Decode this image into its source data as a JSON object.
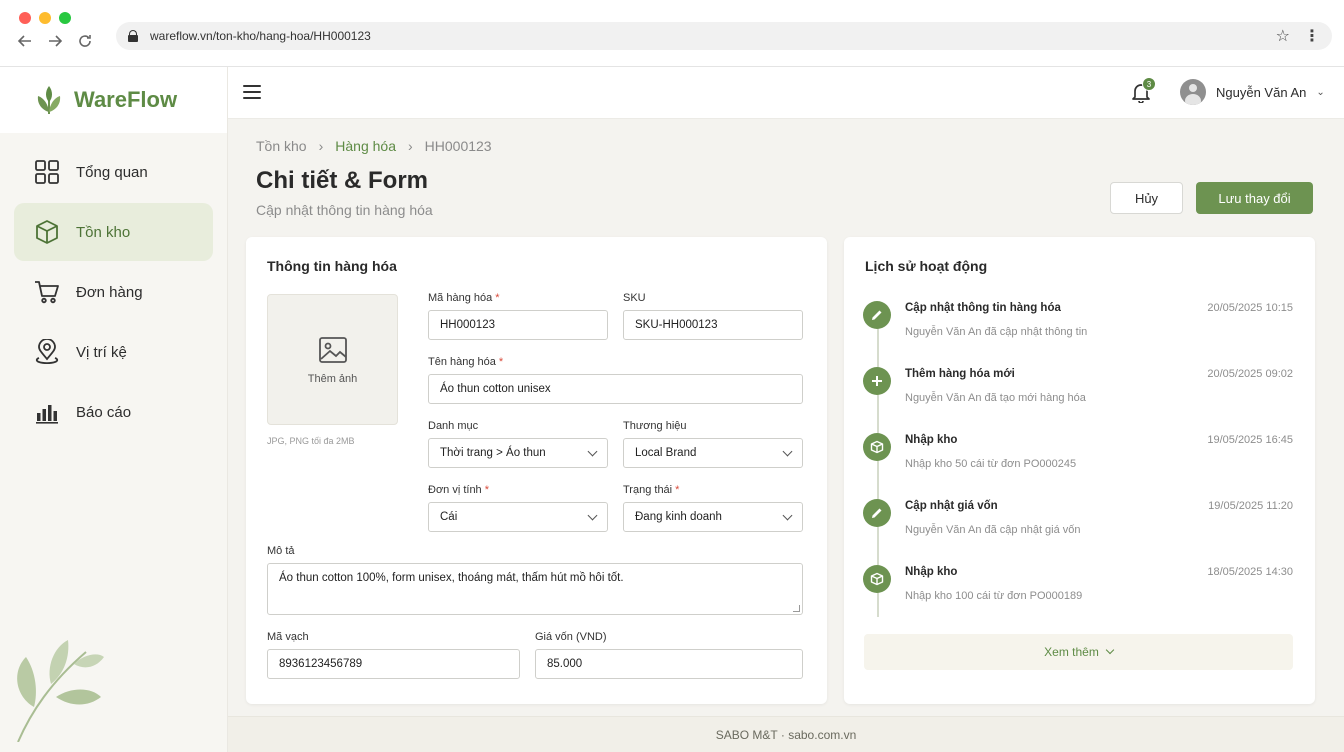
{
  "browser": {
    "url": "wareflow.vn/ton-kho/hang-hoa/HH000123",
    "icons": [
      "back-icon",
      "forward-icon",
      "reload-icon",
      "lock-icon",
      "star-icon",
      "kebab-icon"
    ]
  },
  "brand": {
    "name": "WareFlow",
    "color": "#5e8b45"
  },
  "sidebar": {
    "items": [
      {
        "label": "Tổng quan",
        "icon": "grid-icon",
        "active": false
      },
      {
        "label": "Tồn kho",
        "icon": "box-icon",
        "active": true
      },
      {
        "label": "Đơn hàng",
        "icon": "cart-icon",
        "active": false
      },
      {
        "label": "Vị trí kệ",
        "icon": "location-pin-icon",
        "active": false
      },
      {
        "label": "Báo cáo",
        "icon": "bar-chart-icon",
        "active": false
      }
    ]
  },
  "header": {
    "notification_count": "3",
    "user_name": "Nguyễn Văn An"
  },
  "breadcrumb": [
    "Tồn kho",
    "Hàng hóa",
    "HH000123"
  ],
  "page": {
    "title": "Chi tiết & Form",
    "subtitle": "Cập nhật thông tin hàng hóa",
    "cancel_label": "Hủy",
    "save_label": "Lưu thay đổi"
  },
  "form": {
    "title": "Thông tin hàng hóa",
    "image": {
      "label": "Thêm ảnh",
      "hint": "JPG, PNG tối đa 2MB"
    },
    "code": {
      "label": "Mã hàng hóa",
      "value": "HH000123"
    },
    "sku": {
      "label": "SKU",
      "value": "SKU-HH000123"
    },
    "name": {
      "label": "Tên hàng hóa",
      "value": "Áo thun cotton unisex"
    },
    "category": {
      "label": "Danh mục",
      "value": "Thời trang > Áo thun"
    },
    "brand": {
      "label": "Thương hiệu",
      "value": "Local Brand"
    },
    "unit": {
      "label": "Đơn vị tính",
      "value": "Cái"
    },
    "status": {
      "label": "Trạng thái",
      "value": "Đang kinh doanh"
    },
    "description": {
      "label": "Mô tả",
      "value": "Áo thun cotton 100%, form unisex, thoáng mát, thấm hút mồ hôi tốt."
    },
    "barcode": {
      "label": "Mã vạch",
      "value": "8936123456789"
    },
    "cost": {
      "label": "Giá vốn (VND)",
      "value": "85.000"
    }
  },
  "history": {
    "title": "Lịch sử hoạt động",
    "items": [
      {
        "title": "Cập nhật thông tin hàng hóa",
        "sub": "Nguyễn Văn An đã cập nhật thông tin",
        "time": "20/05/2025 10:15",
        "icon": "pencil-icon"
      },
      {
        "title": "Thêm hàng hóa mới",
        "sub": "Nguyễn Văn An đã tạo mới hàng hóa",
        "time": "20/05/2025 09:02",
        "icon": "plus-icon"
      },
      {
        "title": "Nhập kho",
        "sub": "Nhập kho 50 cái từ đơn PO000245",
        "time": "19/05/2025 16:45",
        "icon": "box-icon"
      },
      {
        "title": "Cập nhật giá vốn",
        "sub": "Nguyễn Văn An đã cập nhật giá vốn",
        "time": "19/05/2025 11:20",
        "icon": "pencil-icon"
      },
      {
        "title": "Nhập kho",
        "sub": "Nhập kho 100 cái từ đơn PO000189",
        "time": "18/05/2025 14:30",
        "icon": "box-icon"
      }
    ],
    "more_label": "Xem thêm"
  },
  "footer": {
    "text": "SABO M&T · sabo.com.vn"
  }
}
